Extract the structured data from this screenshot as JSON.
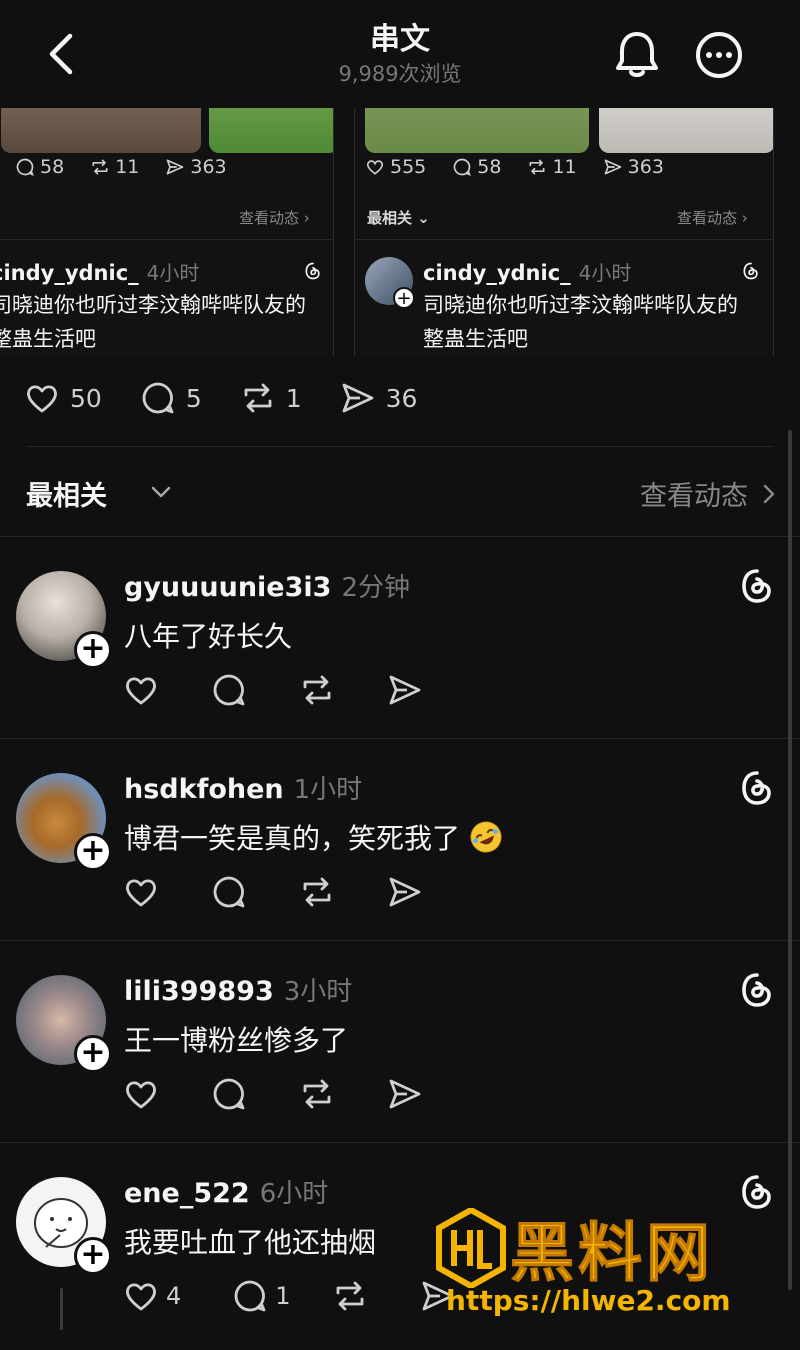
{
  "header": {
    "title": "串文",
    "views": "9,989次浏览"
  },
  "quoted_cards": [
    {
      "stats": {
        "replies": "58",
        "reposts": "11",
        "shares": "363"
      },
      "activity_link": "查看动态",
      "user": "cindy_ydnic_",
      "time": "4小时",
      "text_line1": "司晓迪你也听过李汶翰哔哔队友的",
      "text_line2": "整蛊生活吧"
    },
    {
      "stats": {
        "likes": "555",
        "replies": "58",
        "reposts": "11",
        "shares": "363"
      },
      "sort_label": "最相关",
      "activity_link": "查看动态",
      "user": "cindy_ydnic_",
      "time": "4小时",
      "text_line1": "司晓迪你也听过李汶翰哔哔队友的",
      "text_line2": "整蛊生活吧"
    }
  ],
  "post_actions": {
    "likes": "50",
    "replies": "5",
    "reposts": "1",
    "shares": "36"
  },
  "sort": {
    "label": "最相关",
    "activity_link": "查看动态"
  },
  "replies": [
    {
      "username": "gyuuuunie3i3",
      "time": "2分钟",
      "text": "八年了好长久",
      "likes": "",
      "replies": ""
    },
    {
      "username": "hsdkfohen",
      "time": "1小时",
      "text": "博君一笑是真的，笑死我了",
      "emoji": "rofl-emoji",
      "likes": "",
      "replies": ""
    },
    {
      "username": "lili399893",
      "time": "3小时",
      "text": "王一博粉丝惨多了",
      "likes": "",
      "replies": ""
    },
    {
      "username": "ene_522",
      "time": "6小时",
      "text": "我要吐血了他还抽烟",
      "likes": "4",
      "replies": "1"
    }
  ],
  "watermark": {
    "title": "黑料网",
    "url": "https://hlwe2.com"
  },
  "colors": {
    "background": "#101010",
    "text": "#f3f5f7",
    "muted": "#777777",
    "watermark": "#f5b400"
  }
}
